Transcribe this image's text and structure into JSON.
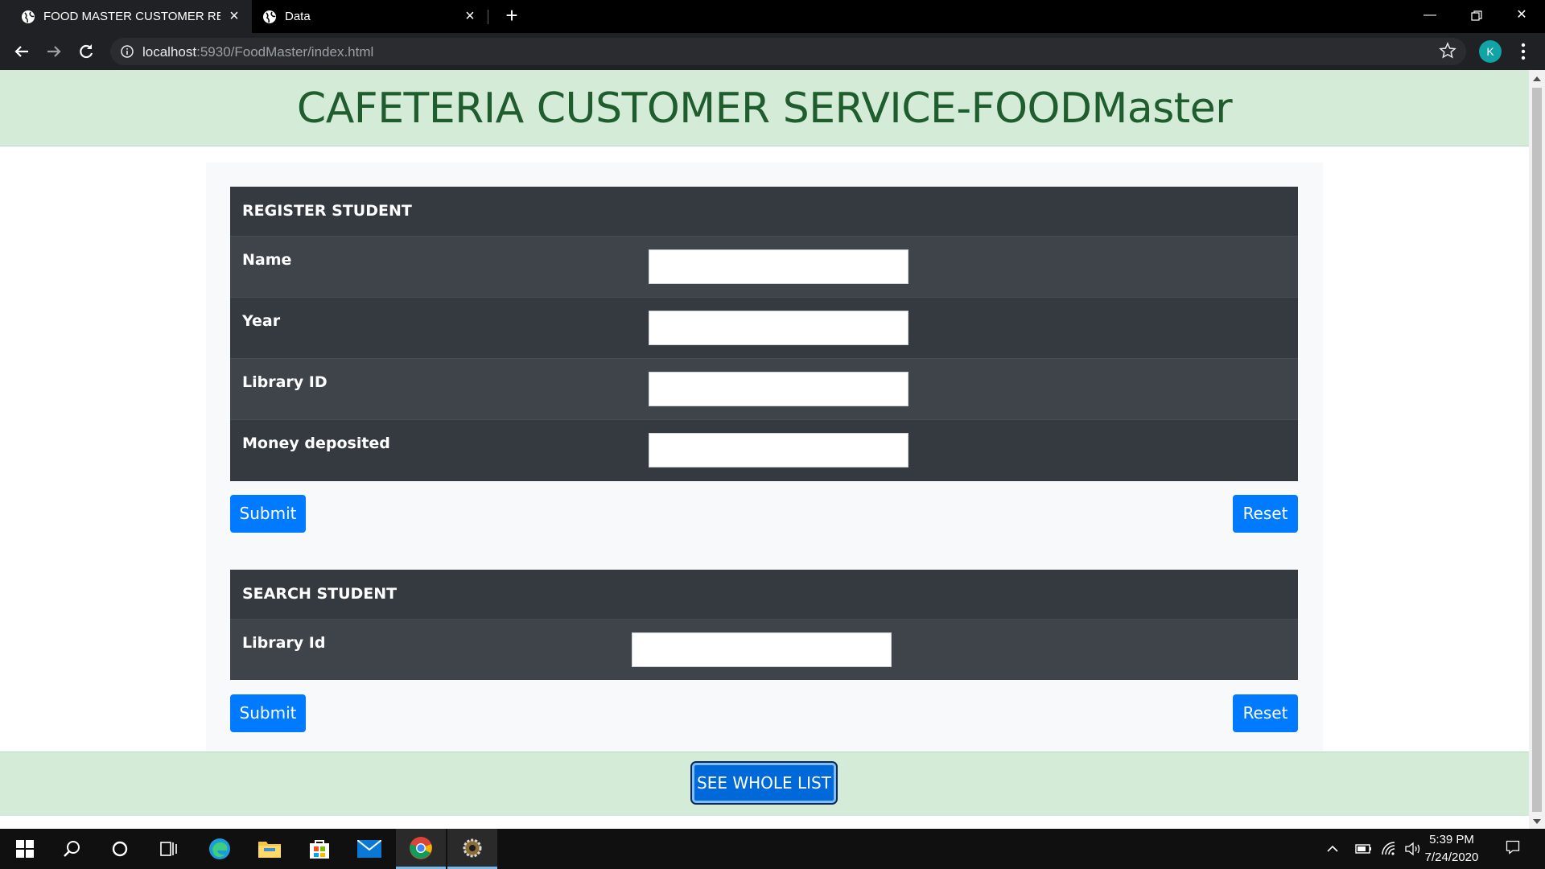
{
  "browser": {
    "tabs": [
      {
        "title": "FOOD MASTER CUSTOMER RECORD",
        "active": true
      },
      {
        "title": "Data",
        "active": false
      }
    ],
    "url_host": "localhost",
    "url_rest": ":5930/FoodMaster/index.html",
    "profile_initial": "K"
  },
  "page": {
    "title": "CAFETERIA CUSTOMER SERVICE-FOODMaster",
    "register": {
      "heading": "REGISTER STUDENT",
      "fields": [
        {
          "label": "Name",
          "value": ""
        },
        {
          "label": "Year",
          "value": ""
        },
        {
          "label": "Library ID",
          "value": ""
        },
        {
          "label": "Money deposited",
          "value": ""
        }
      ],
      "submit_label": "Submit",
      "reset_label": "Reset"
    },
    "search": {
      "heading": "SEARCH STUDENT",
      "fields": [
        {
          "label": "Library Id",
          "value": ""
        }
      ],
      "submit_label": "Submit",
      "reset_label": "Reset"
    },
    "see_list_label": "SEE WHOLE LIST"
  },
  "taskbar": {
    "time": "5:39 PM",
    "date": "7/24/2020",
    "icons": [
      "windows-start",
      "search",
      "cortana",
      "task-view",
      "edge",
      "file-explorer",
      "store",
      "mail",
      "chrome",
      "settings-app"
    ]
  },
  "colors": {
    "header_band": "#d4ebd7",
    "title_text": "#1f5c2e",
    "panel": "#343a40",
    "button": "#007bff"
  }
}
